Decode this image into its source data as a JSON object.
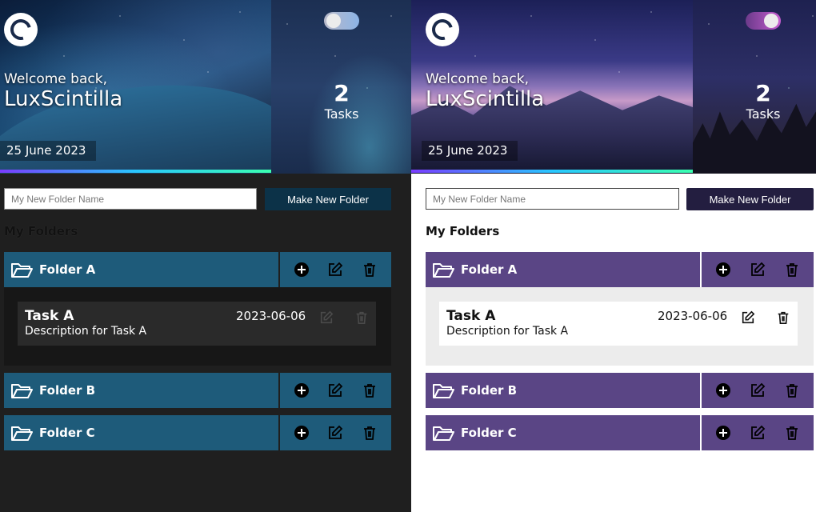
{
  "themes": [
    {
      "id": "dark",
      "user": {
        "welcome": "Welcome back,",
        "name": "LuxScintilla"
      },
      "date": "25 June 2023",
      "tasks": {
        "count": "2",
        "label": "Tasks"
      },
      "form": {
        "placeholder": "My New Folder Name",
        "button": "Make New Folder"
      },
      "section_title": "My Folders",
      "folders": [
        {
          "name": "Folder A"
        },
        {
          "name": "Folder B"
        },
        {
          "name": "Folder C"
        }
      ],
      "task": {
        "title": "Task A",
        "description": "Description for Task A",
        "date": "2023-06-06"
      },
      "colors": {
        "folder_bg": "#1e5b7a",
        "button_bg": "#0c3248",
        "page_bg": "#1f1f1f"
      }
    },
    {
      "id": "light",
      "user": {
        "welcome": "Welcome back,",
        "name": "LuxScintilla"
      },
      "date": "25 June 2023",
      "tasks": {
        "count": "2",
        "label": "Tasks"
      },
      "form": {
        "placeholder": "My New Folder Name",
        "button": "Make New Folder"
      },
      "section_title": "My Folders",
      "folders": [
        {
          "name": "Folder A"
        },
        {
          "name": "Folder B"
        },
        {
          "name": "Folder C"
        }
      ],
      "task": {
        "title": "Task A",
        "description": "Description for Task A",
        "date": "2023-06-06"
      },
      "colors": {
        "folder_bg": "#5a4585",
        "button_bg": "#231e40",
        "page_bg": "#ffffff"
      }
    }
  ],
  "icons": {
    "logo": "moon-crescent-logo",
    "toggle": "theme-toggle",
    "folder": "folder-open-icon",
    "add": "add-circle-icon",
    "edit": "edit-icon",
    "delete": "trash-icon"
  }
}
